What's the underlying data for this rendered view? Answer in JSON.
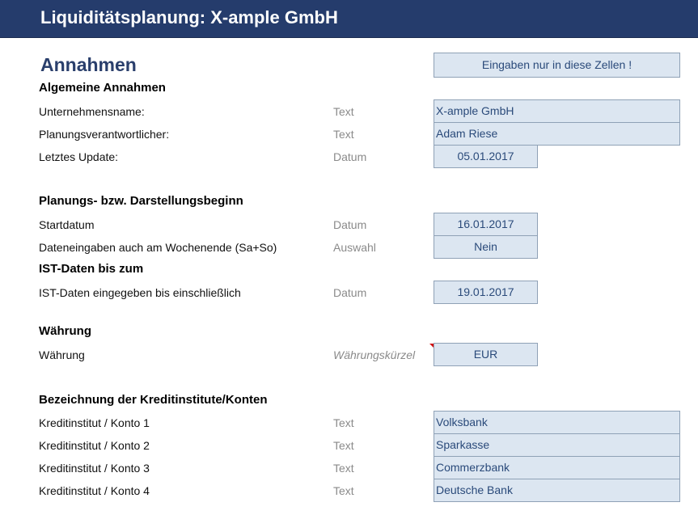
{
  "header": {
    "title": "Liquiditätsplanung: X-ample GmbH"
  },
  "section": {
    "title": "Annahmen",
    "hint": "Eingaben nur in diese Zellen !"
  },
  "groups": {
    "allgemein": "Algemeine Annahmen",
    "beginn": "Planungs- bzw. Darstellungsbeginn",
    "ist": "IST-Daten bis zum",
    "waehrung": "Währung",
    "konten": "Bezeichnung der Kreditinstitute/Konten"
  },
  "rows": {
    "unternehmen": {
      "label": "Unternehmensname:",
      "type": "Text",
      "value": "X-ample GmbH"
    },
    "verantwortlich": {
      "label": "Planungsverantwortlicher:",
      "type": "Text",
      "value": "Adam Riese"
    },
    "update": {
      "label": "Letztes Update:",
      "type": "Datum",
      "value": "05.01.2017"
    },
    "startdatum": {
      "label": "Startdatum",
      "type": "Datum",
      "value": "16.01.2017"
    },
    "wochenende": {
      "label": "Dateneingaben auch am Wochenende (Sa+So)",
      "type": "Auswahl",
      "value": "Nein"
    },
    "istdaten": {
      "label": "IST-Daten eingegeben bis einschließlich",
      "type": "Datum",
      "value": "19.01.2017"
    },
    "waehrung": {
      "label": "Währung",
      "type": "Währungskürzel",
      "value": "EUR"
    },
    "konto1": {
      "label": "Kreditinstitut / Konto 1",
      "type": "Text",
      "value": "Volksbank"
    },
    "konto2": {
      "label": "Kreditinstitut / Konto 2",
      "type": "Text",
      "value": "Sparkasse"
    },
    "konto3": {
      "label": "Kreditinstitut / Konto 3",
      "type": "Text",
      "value": "Commerzbank"
    },
    "konto4": {
      "label": "Kreditinstitut / Konto 4",
      "type": "Text",
      "value": "Deutsche Bank"
    }
  },
  "colors": {
    "header_bg": "#253c6c",
    "input_bg": "#dce6f1",
    "input_text": "#2a4a7a"
  }
}
